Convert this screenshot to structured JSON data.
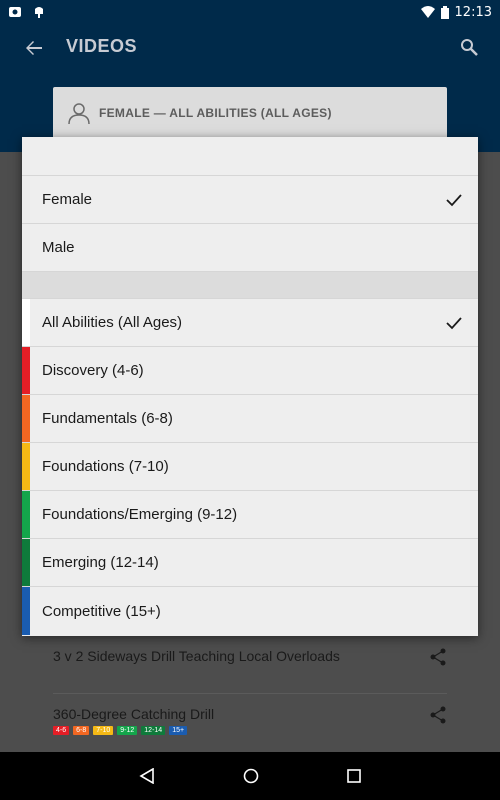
{
  "status_bar": {
    "time": "12:13",
    "left_icons": [
      "notification-icon",
      "android-icon"
    ],
    "right_icons": [
      "wifi-icon",
      "battery-icon"
    ]
  },
  "app_bar": {
    "title": "VIDEOS",
    "back_icon": "arrow-left-icon",
    "search_icon": "search-icon"
  },
  "filter": {
    "label": "FEMALE  —  ALL ABILITIES (ALL AGES)",
    "icon": "person-icon"
  },
  "dialog": {
    "gender_options": [
      {
        "label": "Female",
        "selected": true
      },
      {
        "label": "Male",
        "selected": false
      }
    ],
    "levels": [
      {
        "label": "All Abilities (All Ages)",
        "color": "#ffffff",
        "selected": true
      },
      {
        "label": "Discovery (4-6)",
        "color": "#e41e26",
        "selected": false
      },
      {
        "label": "Fundamentals (6-8)",
        "color": "#f26722",
        "selected": false
      },
      {
        "label": "Foundations (7-10)",
        "color": "#f5b915",
        "selected": false
      },
      {
        "label": "Foundations/Emerging (9-12)",
        "color": "#14a54b",
        "selected": false
      },
      {
        "label": "Emerging (12-14)",
        "color": "#0f7a3b",
        "selected": false
      },
      {
        "label": "Competitive (15+)",
        "color": "#1a5cb0",
        "selected": false
      }
    ]
  },
  "background_list": [
    {
      "title": "3 v 2 Sideways Drill Teaching Local Overloads",
      "tags": []
    },
    {
      "title": "360-Degree Catching Drill",
      "tags": [
        "4-6",
        "6-8",
        "7-10",
        "9-12",
        "12-14",
        "15+"
      ]
    }
  ],
  "tag_colors": [
    "#e41e26",
    "#f26722",
    "#f5b915",
    "#14a54b",
    "#0f7a3b",
    "#1a5cb0"
  ],
  "nav": {
    "back": "nav-back-icon",
    "home": "nav-home-icon",
    "recents": "nav-recents-icon"
  }
}
